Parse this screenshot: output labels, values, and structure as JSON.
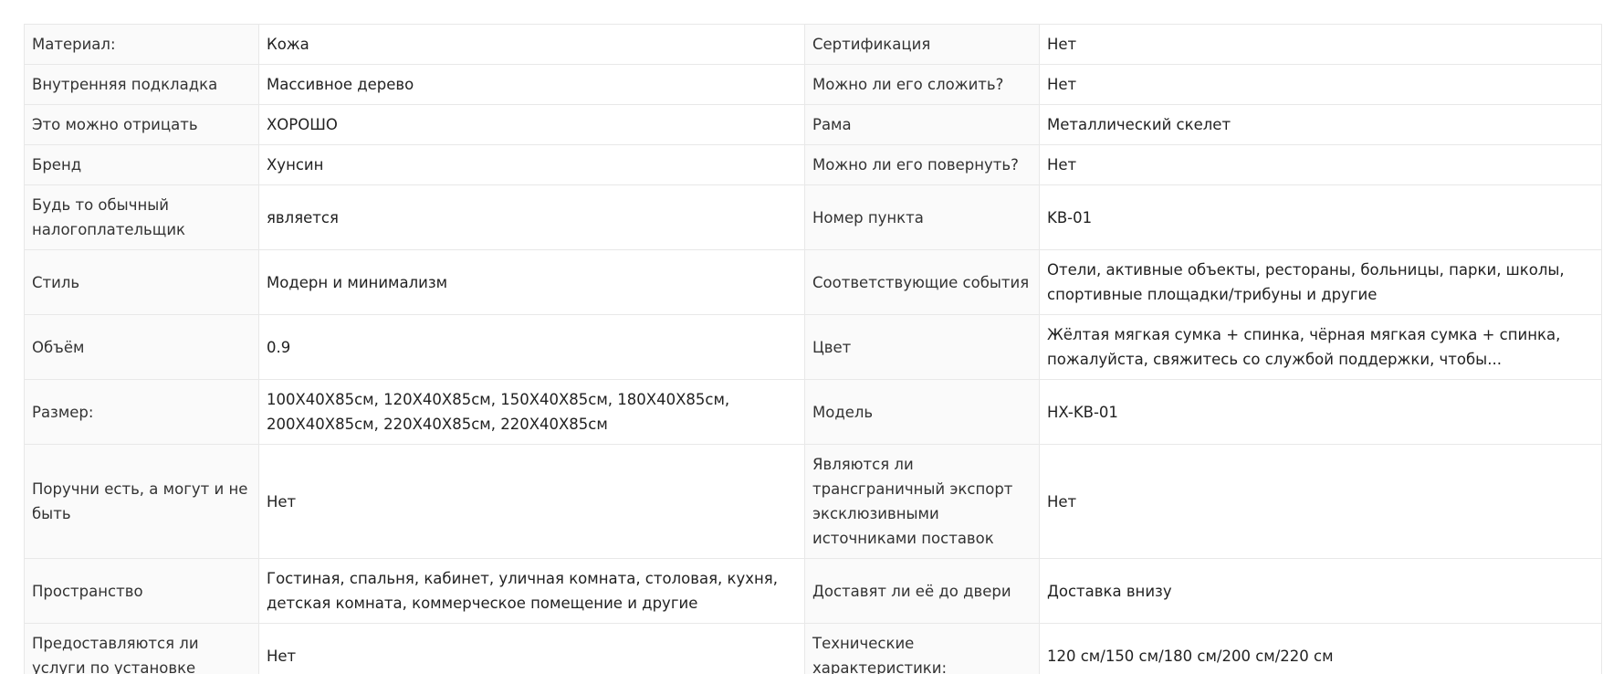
{
  "section": {
    "heading": ""
  },
  "rows": [
    {
      "k1": "Материал:",
      "v1": "Кожа",
      "k2": "Сертификация",
      "v2": "Нет"
    },
    {
      "k1": "Внутренняя подкладка",
      "v1": "Массивное дерево",
      "k2": "Можно ли его сложить?",
      "v2": "Нет"
    },
    {
      "k1": "Это можно отрицать",
      "v1": "ХОРОШО",
      "k2": "Рама",
      "v2": "Металлический скелет"
    },
    {
      "k1": "Бренд",
      "v1": "Хунсин",
      "k2": "Можно ли его повернуть?",
      "v2": "Нет"
    },
    {
      "k1": "Будь то обычный налогоплательщик",
      "v1": "является",
      "k2": "Номер пункта",
      "v2": "KB-01"
    },
    {
      "k1": "Стиль",
      "v1": "Модерн и минимализм",
      "k2": "Соответствующие события",
      "v2": "Отели, активные объекты, рестораны, больницы, парки, школы, спортивные площадки/трибуны и другие"
    },
    {
      "k1": "Объём",
      "v1": "0.9",
      "k2": "Цвет",
      "v2": "Жёлтая мягкая сумка + спинка, чёрная мягкая сумка + спинка, пожалуйста, свяжитесь со службой поддержки, чтобы..."
    },
    {
      "k1": "Размер:",
      "v1": "100X40X85см, 120X40X85см, 150X40X85см, 180X40X85см, 200X40X85см, 220X40X85см, 220X40X85см",
      "k2": "Модель",
      "v2": "HX-KB-01"
    },
    {
      "k1": "Поручни есть, а могут и не быть",
      "v1": "Нет",
      "k2": "Являются ли трансграничный экспорт эксклюзивными источниками поставок",
      "v2": "Нет"
    },
    {
      "k1": "Пространство",
      "v1": "Гостиная, спальня, кабинет, уличная комната, столовая, кухня, детская комната, коммерческое помещение и другие",
      "k2": "Доставят ли её до двери",
      "v2": "Доставка внизу"
    },
    {
      "k1": "Предоставляются ли услуги по установке",
      "v1": "Нет",
      "k2": "Технические характеристики:",
      "v2": "120 см/150 см/180 см/200 см/220 см"
    }
  ]
}
